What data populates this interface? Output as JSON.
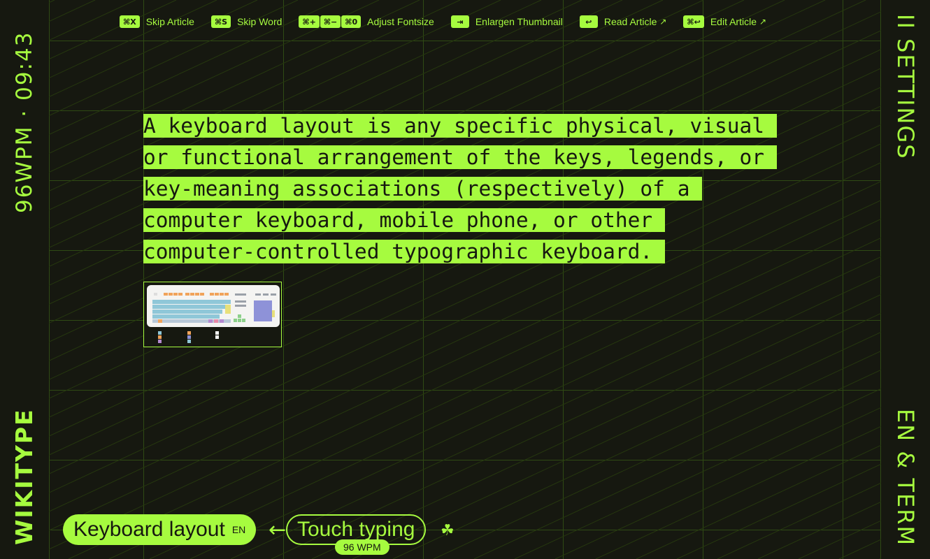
{
  "shortcuts": [
    {
      "keys": [
        "⌘X"
      ],
      "label": "Skip Article"
    },
    {
      "keys": [
        "⌘S"
      ],
      "label": "Skip Word"
    },
    {
      "keys": [
        "⌘+",
        "⌘−",
        "⌘0"
      ],
      "label": "Adjust Fontsize"
    },
    {
      "keys": [
        "⇥"
      ],
      "label": "Enlargen Thumbnail"
    },
    {
      "keys": [
        "↩"
      ],
      "label": "Read Article",
      "external": "↗"
    },
    {
      "keys": [
        "⌘↩"
      ],
      "label": "Edit Article",
      "external": "↗"
    }
  ],
  "status": {
    "text": "96WPM · 09:43"
  },
  "brand": {
    "text": "WIKITYPE"
  },
  "settings": {
    "text": "II SETTINGS"
  },
  "language": {
    "text": "EN & TERM"
  },
  "article": {
    "lines": [
      "A keyboard layout is any specific physical, visual",
      "or functional arrangement of the keys, legends, or",
      "key-meaning associations (respectively) of a",
      "computer keyboard, mobile phone, or other",
      "computer-controlled typographic keyboard."
    ]
  },
  "thumbnail": {
    "icon": "keyboard-layout-thumbnail"
  },
  "bottom": {
    "current_title": "Keyboard layout",
    "current_lang": "EN",
    "arrow": "←",
    "next_title": "Touch typing",
    "wpm_badge": "96 WPM",
    "clover": "☘"
  },
  "colors": {
    "accent": "#a6fb3f",
    "background": "#161810"
  }
}
